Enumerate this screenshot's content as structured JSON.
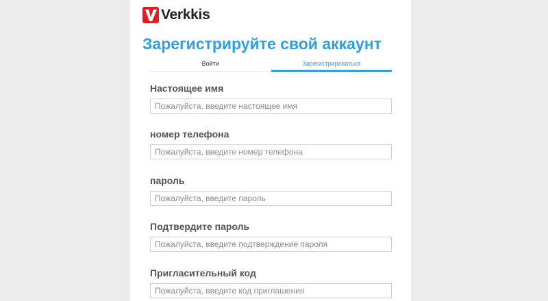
{
  "brand": {
    "name": "Verkkis",
    "color": "#e02020"
  },
  "page": {
    "title": "Зарегистрируйте свой аккаунт",
    "accent_color": "#2ea0e0"
  },
  "tabs": [
    {
      "label": "Войти",
      "active": false
    },
    {
      "label": "Зарегистрироваться",
      "active": true
    }
  ],
  "form": {
    "fields": [
      {
        "label": "Настоящее имя",
        "placeholder": "Пожалуйста, введите настоящее имя",
        "value": ""
      },
      {
        "label": "номер телефона",
        "placeholder": "Пожалуйста, введите номер телефона",
        "value": ""
      },
      {
        "label": "пароль",
        "placeholder": "Пожалуйста, введите пароль",
        "value": ""
      },
      {
        "label": "Подтвердите пароль",
        "placeholder": "Пожалуйста, введите подтверждение пароля",
        "value": ""
      },
      {
        "label": "Пригласительный код",
        "placeholder": "Пожалуйста, введите код приглашения",
        "value": ""
      }
    ]
  }
}
